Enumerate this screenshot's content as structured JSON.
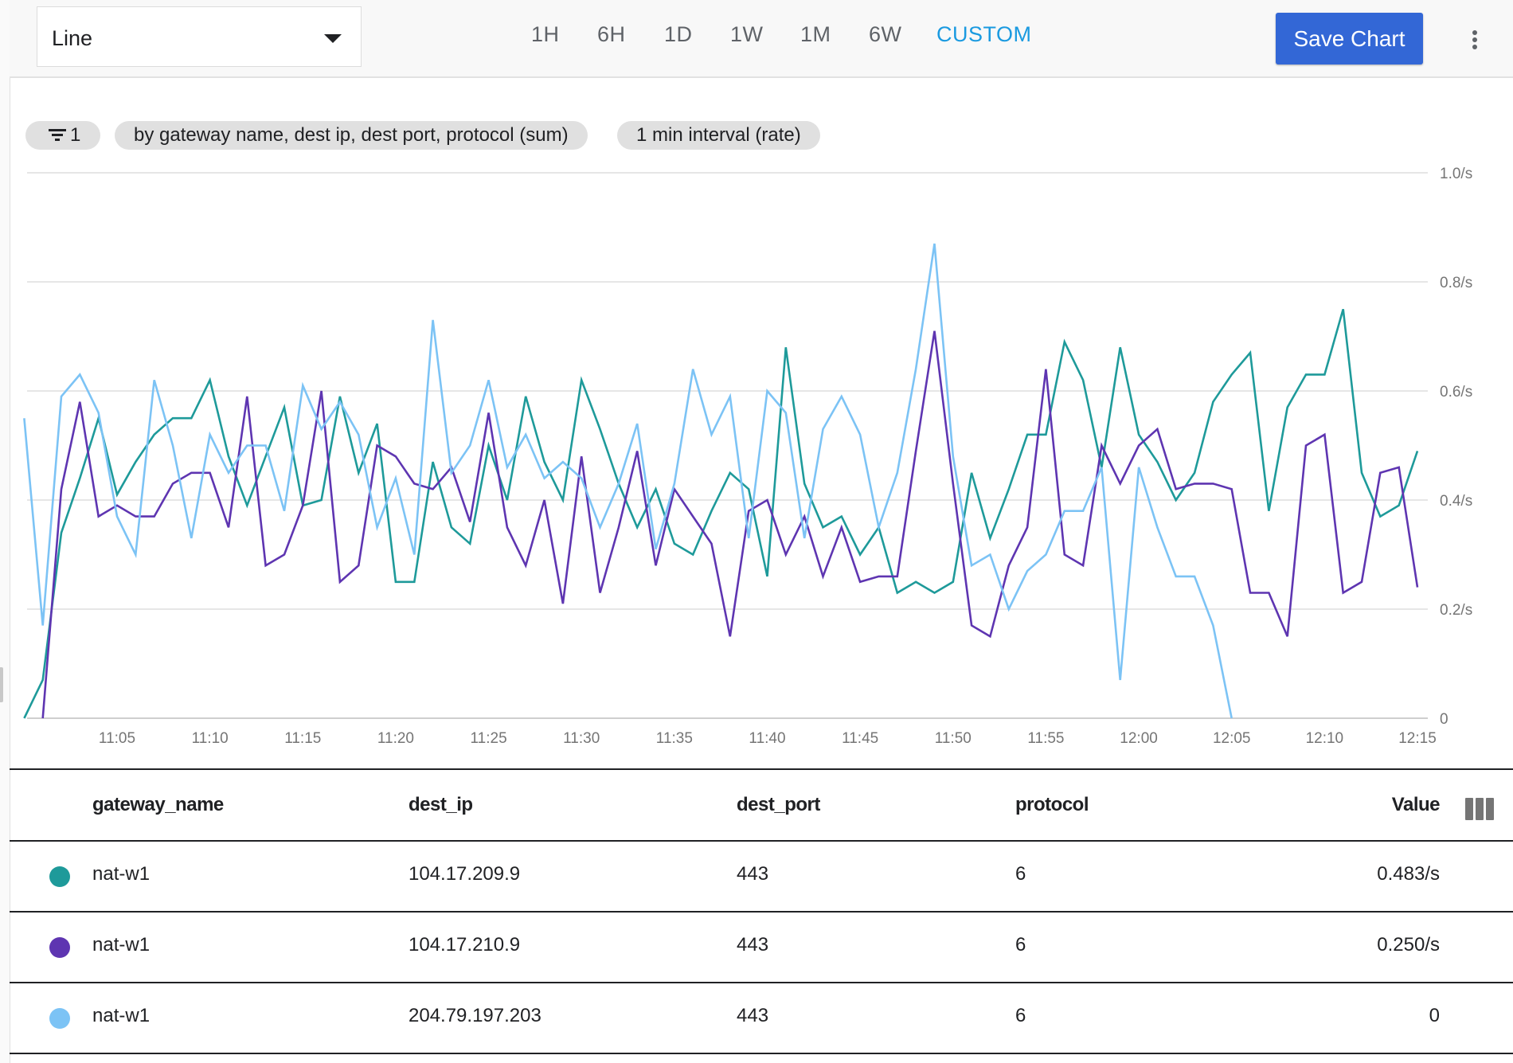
{
  "toolbar": {
    "chart_type": "Line",
    "time_ranges": [
      "1H",
      "6H",
      "1D",
      "1W",
      "1M",
      "6W",
      "CUSTOM"
    ],
    "active_range": "CUSTOM",
    "save_label": "Save Chart",
    "more_icon": "more-vert-icon",
    "accent_color": "#1a9ae0",
    "save_color": "#3367d6"
  },
  "chips": {
    "filter_count": "1",
    "filter_icon": "filter-list-icon",
    "group_by": "by gateway name, dest ip, dest port, protocol (sum)",
    "interval": "1 min interval (rate)"
  },
  "chart_data": {
    "type": "line",
    "title": "",
    "xlabel": "",
    "ylabel": "",
    "ylim": [
      0,
      1.0
    ],
    "y_ticks": [
      {
        "value": 0,
        "label": "0"
      },
      {
        "value": 0.2,
        "label": "0.2/s"
      },
      {
        "value": 0.4,
        "label": "0.4/s"
      },
      {
        "value": 0.6,
        "label": "0.6/s"
      },
      {
        "value": 0.8,
        "label": "0.8/s"
      },
      {
        "value": 1.0,
        "label": "1.0/s"
      }
    ],
    "x_start": "11:00",
    "x_step_minutes": 1,
    "x_ticks": [
      "11:05",
      "11:10",
      "11:15",
      "11:20",
      "11:25",
      "11:30",
      "11:35",
      "11:40",
      "11:45",
      "11:50",
      "11:55",
      "12:00",
      "12:05",
      "12:10",
      "12:15"
    ],
    "grid": true,
    "legend": "table-below",
    "series": [
      {
        "name": "nat-w1 / 104.17.209.9",
        "color": "#1e9a9a",
        "values": [
          0.0,
          0.07,
          0.34,
          0.44,
          0.55,
          0.41,
          0.47,
          0.52,
          0.55,
          0.55,
          0.62,
          0.48,
          0.39,
          0.48,
          0.57,
          0.39,
          0.4,
          0.59,
          0.45,
          0.54,
          0.25,
          0.25,
          0.47,
          0.35,
          0.32,
          0.5,
          0.4,
          0.59,
          0.47,
          0.4,
          0.62,
          0.53,
          0.43,
          0.35,
          0.42,
          0.32,
          0.3,
          0.38,
          0.45,
          0.42,
          0.26,
          0.68,
          0.43,
          0.35,
          0.37,
          0.3,
          0.35,
          0.23,
          0.25,
          0.23,
          0.25,
          0.45,
          0.33,
          0.42,
          0.52,
          0.52,
          0.69,
          0.62,
          0.46,
          0.68,
          0.52,
          0.47,
          0.4,
          0.45,
          0.58,
          0.63,
          0.67,
          0.38,
          0.57,
          0.63,
          0.63,
          0.75,
          0.45,
          0.37,
          0.39,
          0.49
        ]
      },
      {
        "name": "nat-w1 / 104.17.210.9",
        "color": "#5e35b1",
        "values": [
          null,
          0.0,
          0.42,
          0.58,
          0.37,
          0.39,
          0.37,
          0.37,
          0.43,
          0.45,
          0.45,
          0.35,
          0.59,
          0.28,
          0.3,
          0.39,
          0.6,
          0.25,
          0.28,
          0.5,
          0.48,
          0.43,
          0.42,
          0.46,
          0.36,
          0.56,
          0.35,
          0.28,
          0.4,
          0.21,
          0.48,
          0.23,
          0.35,
          0.49,
          0.28,
          0.42,
          0.37,
          0.32,
          0.15,
          0.38,
          0.4,
          0.3,
          0.37,
          0.26,
          0.35,
          0.25,
          0.26,
          0.26,
          0.49,
          0.71,
          0.43,
          0.17,
          0.15,
          0.28,
          0.35,
          0.64,
          0.3,
          0.28,
          0.5,
          0.43,
          0.5,
          0.53,
          0.42,
          0.43,
          0.43,
          0.42,
          0.23,
          0.23,
          0.15,
          0.5,
          0.52,
          0.23,
          0.25,
          0.45,
          0.46,
          0.24
        ]
      },
      {
        "name": "nat-w1 / 204.79.197.203",
        "color": "#7cc3f5",
        "values": [
          0.55,
          0.17,
          0.59,
          0.63,
          0.56,
          0.37,
          0.3,
          0.62,
          0.5,
          0.33,
          0.52,
          0.45,
          0.5,
          0.5,
          0.38,
          0.61,
          0.53,
          0.58,
          0.52,
          0.35,
          0.44,
          0.3,
          0.73,
          0.45,
          0.5,
          0.62,
          0.46,
          0.52,
          0.44,
          0.47,
          0.44,
          0.35,
          0.43,
          0.54,
          0.31,
          0.43,
          0.64,
          0.52,
          0.59,
          0.33,
          0.6,
          0.56,
          0.33,
          0.53,
          0.59,
          0.52,
          0.35,
          0.45,
          0.64,
          0.87,
          0.48,
          0.28,
          0.3,
          0.2,
          0.27,
          0.3,
          0.38,
          0.38,
          0.46,
          0.07,
          0.46,
          0.35,
          0.26,
          0.26,
          0.17,
          0.0
        ]
      }
    ]
  },
  "table": {
    "columns": [
      "gateway_name",
      "dest_ip",
      "dest_port",
      "protocol",
      "Value"
    ],
    "column_settings_icon": "view-column-icon",
    "rows": [
      {
        "color": "#1e9a9a",
        "gateway_name": "nat-w1",
        "dest_ip": "104.17.209.9",
        "dest_port": "443",
        "protocol": "6",
        "value": "0.483/s"
      },
      {
        "color": "#5e35b1",
        "gateway_name": "nat-w1",
        "dest_ip": "104.17.210.9",
        "dest_port": "443",
        "protocol": "6",
        "value": "0.250/s"
      },
      {
        "color": "#7cc3f5",
        "gateway_name": "nat-w1",
        "dest_ip": "204.79.197.203",
        "dest_port": "443",
        "protocol": "6",
        "value": "0"
      }
    ]
  }
}
